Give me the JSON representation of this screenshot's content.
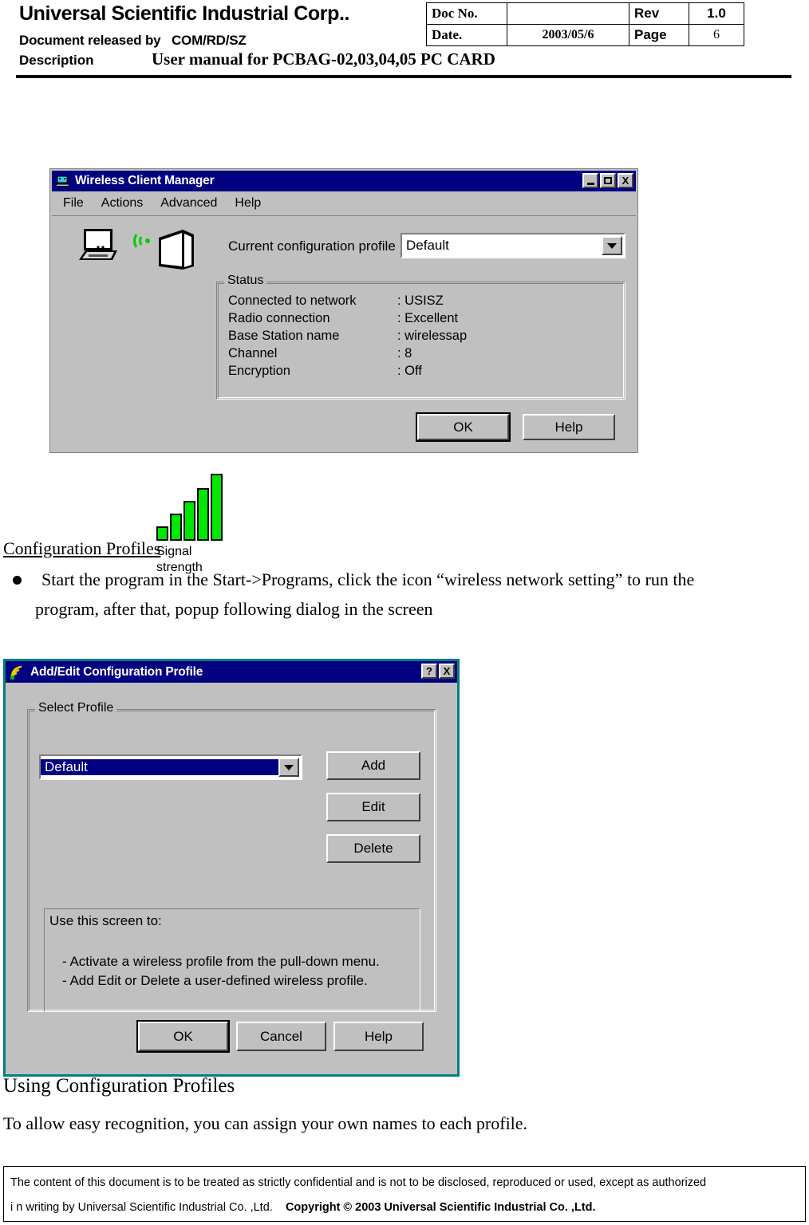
{
  "header": {
    "company": "Universal Scientific Industrial Corp..",
    "released_label": "Document released by",
    "released_value": "COM/RD/SZ",
    "description_label": "Description",
    "description_value": "User manual for PCBAG-02,03,04,05 PC CARD",
    "table": {
      "doc_no_label": "Doc No.",
      "doc_no_value": "",
      "rev_label": "Rev",
      "rev_value": "1.0",
      "date_label": "Date.",
      "date_value": "2003/05/6",
      "page_label": "Page",
      "page_value": "6"
    }
  },
  "dialog1": {
    "title": "Wireless Client Manager",
    "title_icon": "laptop-monitor-icon",
    "window_buttons": {
      "minimize": "minimize-icon",
      "maximize": "maximize-icon",
      "close": "X"
    },
    "menu": [
      "File",
      "Actions",
      "Advanced",
      "Help"
    ],
    "profile_label": "Current configuration profile",
    "profile_value": "Default",
    "status_group_label": "Status",
    "status_rows": [
      {
        "key": "Connected to network",
        "value": ": USISZ"
      },
      {
        "key": "Radio connection",
        "value": ": Excellent"
      },
      {
        "key": "Base Station name",
        "value": ": wirelessap"
      },
      {
        "key": "Channel",
        "value": ": 8"
      },
      {
        "key": "Encryption",
        "value": ": Off"
      }
    ],
    "signal_label_line1": "Signal",
    "signal_label_line2": "strength",
    "signal_bars": [
      18,
      34,
      50,
      66,
      84
    ],
    "signal_bar_color": "#00e800",
    "buttons": {
      "ok": "OK",
      "help": "Help"
    }
  },
  "section1": {
    "heading": "Configuration Profiles",
    "bullet_line1": "Start the program in the Start->Programs, click the icon “wireless network setting” to run the",
    "bullet_line2": "program, after that, popup following dialog in the screen"
  },
  "dialog2": {
    "title": "Add/Edit Configuration Profile",
    "title_icon": "wireless-signal-icon",
    "window_buttons": {
      "help": "?",
      "close": "X"
    },
    "group_label": "Select Profile",
    "profile_value": "Default",
    "side_buttons": [
      "Add",
      "Edit",
      "Delete"
    ],
    "info_title": "Use this screen to:",
    "info_lines": [
      "-  Activate a wireless profile from the pull-down menu.",
      "-  Add Edit or Delete a user-defined wireless profile."
    ],
    "buttons": {
      "ok": "OK",
      "cancel": "Cancel",
      "help": "Help"
    },
    "border_color": "#008080"
  },
  "section2": {
    "heading": "Using Configuration Profiles",
    "paragraph": "To allow easy recognition, you can assign your own names to each profile."
  },
  "footer": {
    "line1": "The content of this document is to be treated as strictly confidential and is not to be disclosed, reproduced or used, except as authorized",
    "line2_plain": "i n writing by Universal Scientific Industrial Co. ,Ltd.",
    "line2_bold": "Copyright © 2003 Universal Scientific Industrial Co. ,Ltd."
  }
}
